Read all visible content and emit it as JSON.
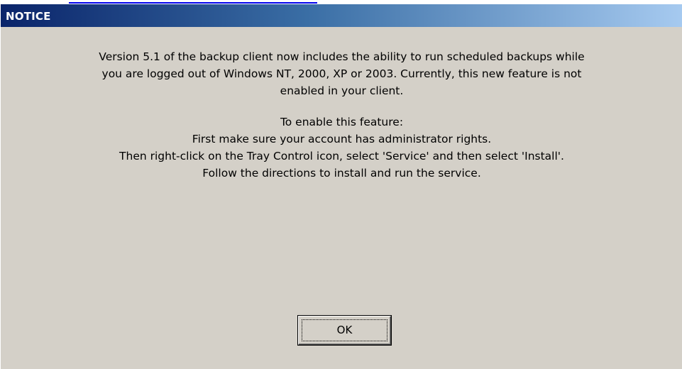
{
  "dialog": {
    "title": "NOTICE",
    "paragraph1": [
      "Version 5.1 of the backup client now includes the ability to run scheduled backups while",
      "you are logged out of Windows NT, 2000, XP or 2003. Currently, this new feature is not",
      "enabled in your client."
    ],
    "paragraph2": [
      "To enable this feature:",
      "First make sure your account has administrator rights.",
      "Then right-click on the Tray Control icon, select 'Service' and then select 'Install'.",
      "Follow the directions to install and run the service."
    ],
    "ok_label": "OK"
  },
  "colors": {
    "dialog_background": "#d4d0c8",
    "titlebar_start": "#0a246a",
    "titlebar_end": "#a6caf0",
    "title_text": "#ffffff",
    "link": "#0000ee"
  }
}
